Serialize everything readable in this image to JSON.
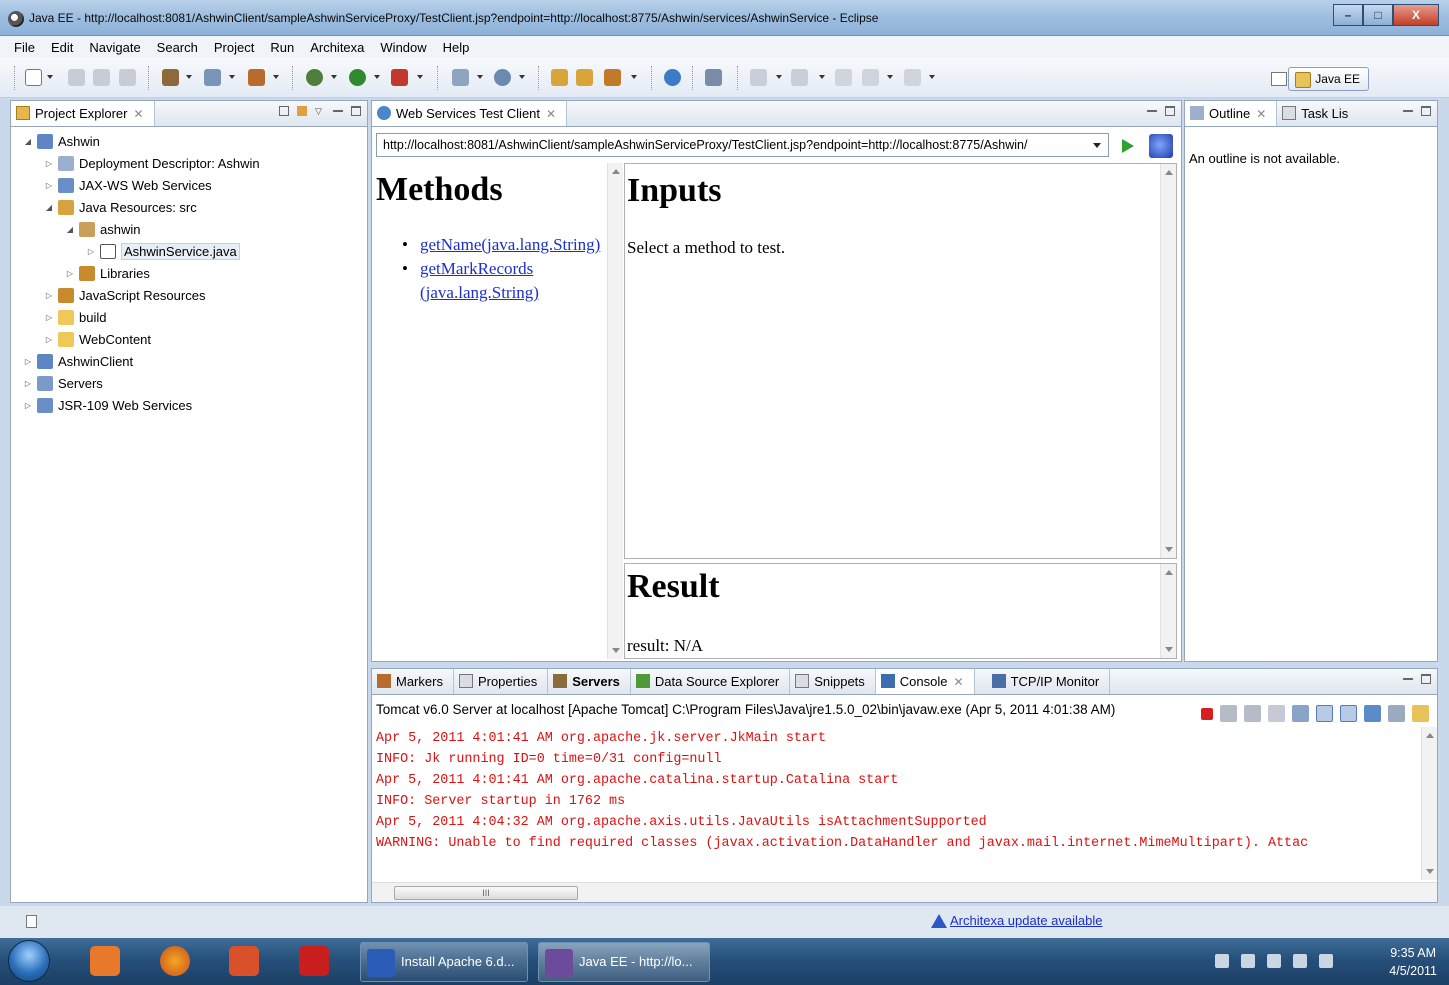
{
  "window": {
    "title": "Java EE - http://localhost:8081/AshwinClient/sampleAshwinServiceProxy/TestClient.jsp?endpoint=http://localhost:8775/Ashwin/services/AshwinService - Eclipse"
  },
  "menu": [
    "File",
    "Edit",
    "Navigate",
    "Search",
    "Project",
    "Run",
    "Architexa",
    "Window",
    "Help"
  ],
  "toolbar": {
    "perspective": "Java EE"
  },
  "project_explorer": {
    "tab": "Project Explorer",
    "nodes": [
      {
        "label": "Ashwin"
      },
      {
        "label": "Deployment Descriptor: Ashwin"
      },
      {
        "label": "JAX-WS Web Services"
      },
      {
        "label": "Java Resources: src"
      },
      {
        "label": "ashwin"
      },
      {
        "label": "AshwinService.java"
      },
      {
        "label": "Libraries"
      },
      {
        "label": "JavaScript Resources"
      },
      {
        "label": "build"
      },
      {
        "label": "WebContent"
      },
      {
        "label": "AshwinClient"
      },
      {
        "label": "Servers"
      },
      {
        "label": "JSR-109 Web Services"
      }
    ]
  },
  "ws_client": {
    "tab": "Web Services Test Client",
    "url": "http://localhost:8081/AshwinClient/sampleAshwinServiceProxy/TestClient.jsp?endpoint=http://localhost:8775/Ashwin/",
    "methods_title": "Methods",
    "methods": [
      "getName(java.lang.String)",
      "getMarkRecords",
      "(java.lang.String)"
    ],
    "inputs_title": "Inputs",
    "inputs_text": "Select a method to test.",
    "result_title": "Result",
    "result_text": "result: N/A"
  },
  "outline": {
    "tab": "Outline",
    "tab2": "Task Lis",
    "message": "An outline is not available."
  },
  "bottom_tabs": [
    "Markers",
    "Properties",
    "Servers",
    "Data Source Explorer",
    "Snippets",
    "Console",
    "TCP/IP Monitor"
  ],
  "console": {
    "header": "Tomcat v6.0 Server at localhost [Apache Tomcat] C:\\Program Files\\Java\\jre1.5.0_02\\bin\\javaw.exe (Apr 5, 2011 4:01:38 AM)",
    "lines": [
      "Apr 5, 2011 4:01:41 AM org.apache.jk.server.JkMain start",
      "INFO: Jk running ID=0 time=0/31  config=null",
      "Apr 5, 2011 4:01:41 AM org.apache.catalina.startup.Catalina start",
      "INFO: Server startup in 1762 ms",
      "Apr 5, 2011 4:04:32 AM org.apache.axis.utils.JavaUtils isAttachmentSupported",
      "WARNING: Unable to find required classes (javax.activation.DataHandler and javax.mail.internet.MimeMultipart). Attac"
    ],
    "scroll_glyph": "III"
  },
  "status": {
    "update": "Architexa update available"
  },
  "taskbar": {
    "buttons": [
      "Install Apache 6.d...",
      "Java EE - http://lo..."
    ],
    "time": "9:35 AM",
    "date": "4/5/2011"
  }
}
